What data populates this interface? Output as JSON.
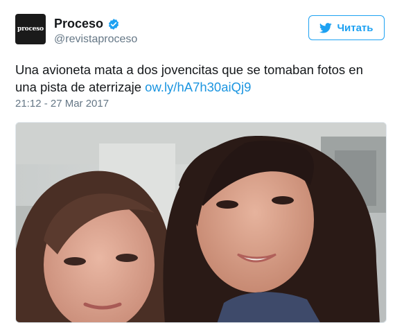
{
  "account": {
    "avatar_text": "proceso",
    "display_name": "Proceso",
    "handle": "@revistaproceso"
  },
  "follow_button": {
    "label": "Читать"
  },
  "tweet": {
    "text": "Una avioneta mata a dos jovencitas que se tomaban fotos en una pista de aterrizaje ",
    "link": "ow.ly/hA7h30aiQj9",
    "timestamp": "21:12 - 27 Mar 2017"
  },
  "colors": {
    "accent": "#1da1f2",
    "link": "#1b95e0",
    "muted": "#657786"
  },
  "icons": [
    "verified-badge-icon",
    "twitter-bird-icon"
  ]
}
